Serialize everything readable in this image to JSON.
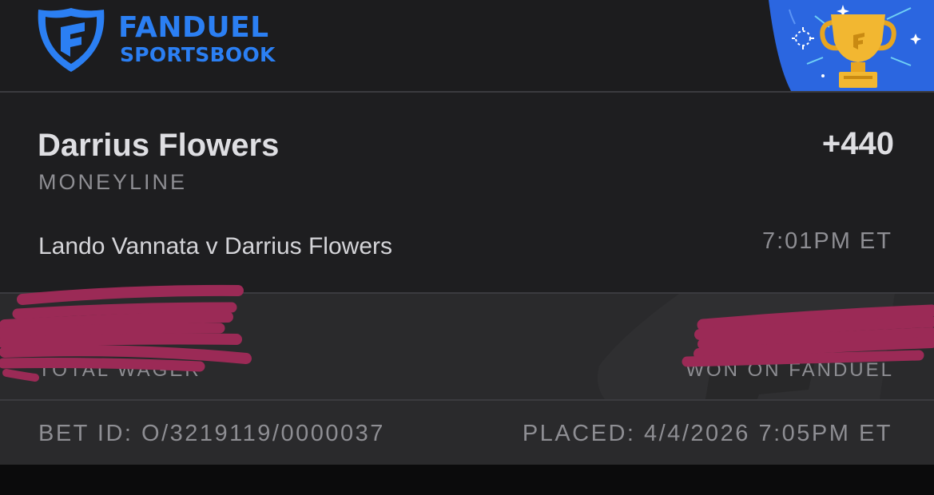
{
  "header": {
    "brand_line1": "FANDUEL",
    "brand_line2": "SPORTSBOOK",
    "brand_color": "#2b7ff3",
    "logo_icon": "fanduel-shield-icon",
    "badge_icon": "trophy-icon"
  },
  "bet": {
    "selection": "Darrius Flowers",
    "market": "MONEYLINE",
    "odds": "+440",
    "event": "Lando Vannata v Darrius Flowers",
    "time": "7:01PM ET"
  },
  "wager": {
    "total_wager_label": "TOTAL WAGER",
    "won_label": "WON ON FANDUEL",
    "redaction_color": "#9b2a56"
  },
  "footer": {
    "bet_id": "BET ID: O/3219119/0000037",
    "placed": "PLACED: 4/4/2026 7:05PM ET"
  }
}
